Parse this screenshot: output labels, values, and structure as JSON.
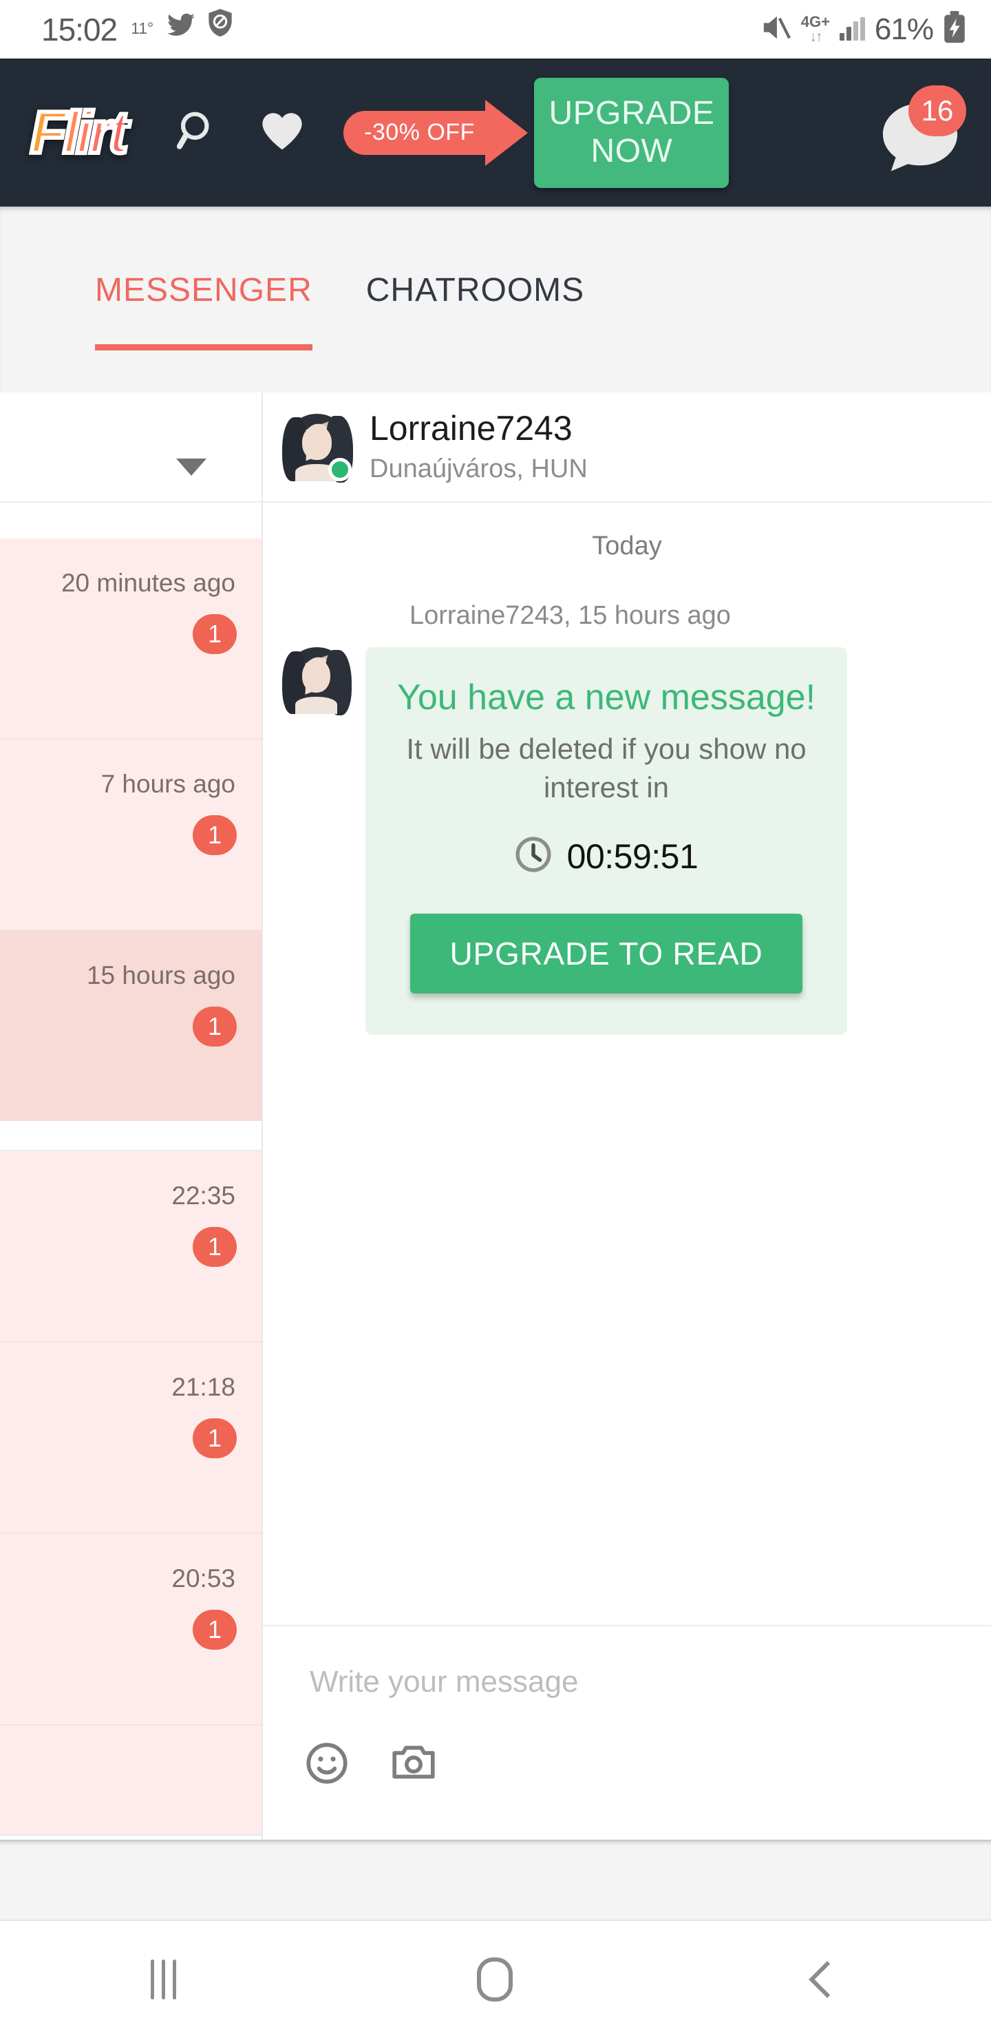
{
  "status_bar": {
    "time": "15:02",
    "temperature": "11°",
    "twitter_icon": "twitter-icon",
    "blocked_icon": "do-not-disturb-shield-icon",
    "mute_icon": "mute-icon",
    "network_type": "4G+",
    "data_arrows": "↓↑",
    "battery_percent": "61%",
    "battery_icon": "battery-charging-icon"
  },
  "app_header": {
    "logo_text": "Flirt",
    "search_icon": "search-icon",
    "favorites_icon": "heart-icon",
    "promo_label": "-30% OFF",
    "upgrade_label": "UPGRADE\nNOW",
    "upgrade_line1": "UPGRADE",
    "upgrade_line2": "NOW",
    "messages_icon": "chat-bubble-icon",
    "messages_badge": "16",
    "colors": {
      "bar_bg": "#222B36",
      "promo": "#F2685F",
      "upgrade": "#43B97E"
    }
  },
  "tabs": [
    {
      "label": "MESSENGER",
      "active": true
    },
    {
      "label": "CHATROOMS",
      "active": false
    }
  ],
  "conversation_list": {
    "dropdown_icon": "chevron-down-icon",
    "rows": [
      {
        "time": "20 minutes ago",
        "badge": "1",
        "selected": false
      },
      {
        "time": "7 hours ago",
        "badge": "1",
        "selected": false
      },
      {
        "time": "15 hours ago",
        "badge": "1",
        "selected": true
      },
      {
        "time": "22:35",
        "badge": "1",
        "selected": false
      },
      {
        "time": "21:18",
        "badge": "1",
        "selected": false
      },
      {
        "time": "20:53",
        "badge": "1",
        "selected": false
      }
    ]
  },
  "chat": {
    "name": "Lorraine7243",
    "location": "Dunaújváros, HUN",
    "online_status": "online",
    "day_separator": "Today",
    "message_meta": "Lorraine7243,  15 hours ago",
    "bubble": {
      "title": "You have a new message!",
      "subtitle": "It will be deleted if you show no interest in",
      "clock_icon": "clock-icon",
      "countdown": "00:59:51",
      "cta_label": "UPGRADE TO READ"
    },
    "composer": {
      "placeholder": "Write your message",
      "value": "",
      "emoji_icon": "smiley-icon",
      "camera_icon": "camera-icon"
    }
  },
  "nav_bar": {
    "recents_icon": "recents-icon",
    "home_icon": "home-icon",
    "back_icon": "back-chevron-icon"
  }
}
